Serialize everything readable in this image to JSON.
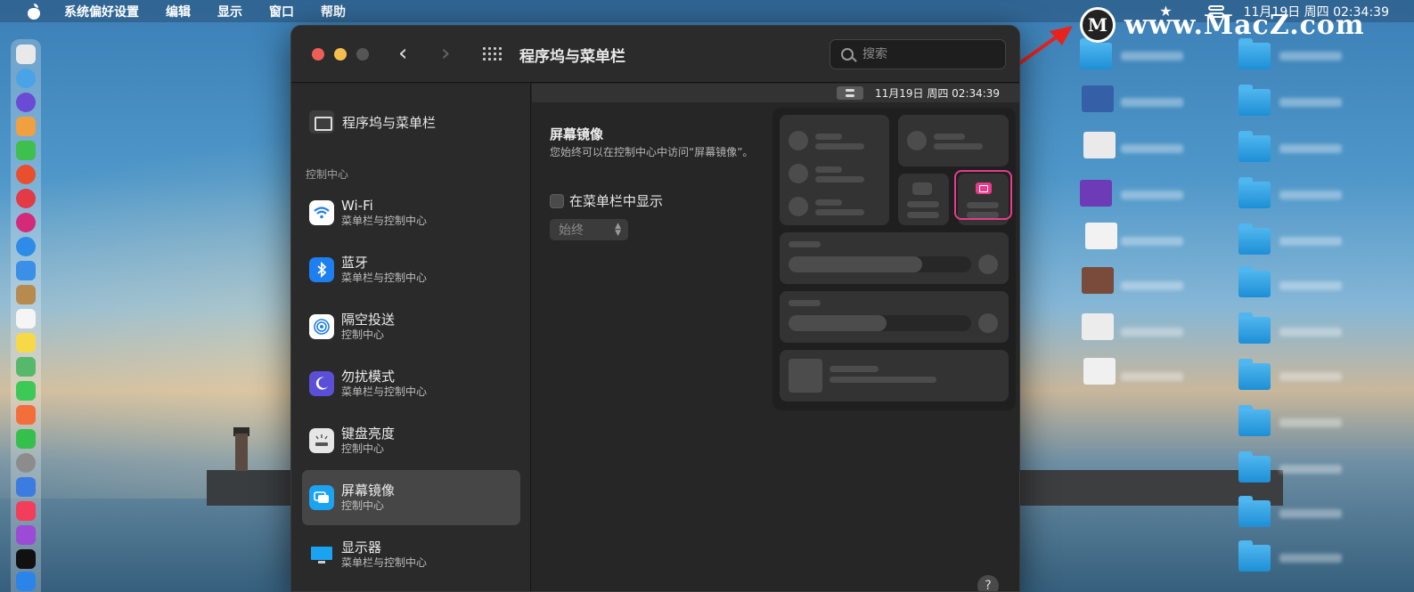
{
  "menubar": {
    "app_name": "系统偏好设置",
    "items": [
      "编辑",
      "显示",
      "窗口",
      "帮助"
    ],
    "clock": "11月19日 周四  02:34:39"
  },
  "watermark": {
    "logo_letter": "M",
    "text": "www.MacZ.com"
  },
  "window": {
    "title": "程序坞与菜单栏",
    "search_placeholder": "搜索"
  },
  "sidebar": {
    "top_item": "程序坞与菜单栏",
    "section_label": "控制中心",
    "items": [
      {
        "title": "Wi-Fi",
        "subtitle": "菜单栏与控制中心",
        "icon": "wifi-icon",
        "color": "#ffffff"
      },
      {
        "title": "蓝牙",
        "subtitle": "菜单栏与控制中心",
        "icon": "bluetooth-icon",
        "color": "#1e7ff0"
      },
      {
        "title": "隔空投送",
        "subtitle": "控制中心",
        "icon": "airdrop-icon",
        "color": "#ffffff"
      },
      {
        "title": "勿扰模式",
        "subtitle": "菜单栏与控制中心",
        "icon": "moon-icon",
        "color": "#5b4fd8"
      },
      {
        "title": "键盘亮度",
        "subtitle": "控制中心",
        "icon": "keyboard-brightness-icon",
        "color": "#e6e6e6"
      },
      {
        "title": "屏幕镜像",
        "subtitle": "控制中心",
        "icon": "screen-mirroring-icon",
        "color": "#1aa3f0"
      },
      {
        "title": "显示器",
        "subtitle": "菜单栏与控制中心",
        "icon": "display-icon",
        "color": "#1aa3f0"
      }
    ],
    "selected_index": 5
  },
  "main": {
    "mini_clock": "11月19日 周四  02:34:39",
    "feature_title": "屏幕镜像",
    "feature_desc": "您始终可以在控制中心中访问“屏幕镜像”。",
    "checkbox_label": "在菜单栏中显示",
    "checkbox_checked": false,
    "select_value": "始终",
    "help_label": "?"
  },
  "colors": {
    "highlight": "#e83b8a",
    "window_bg": "#252525",
    "arrow": "#e8231e"
  }
}
